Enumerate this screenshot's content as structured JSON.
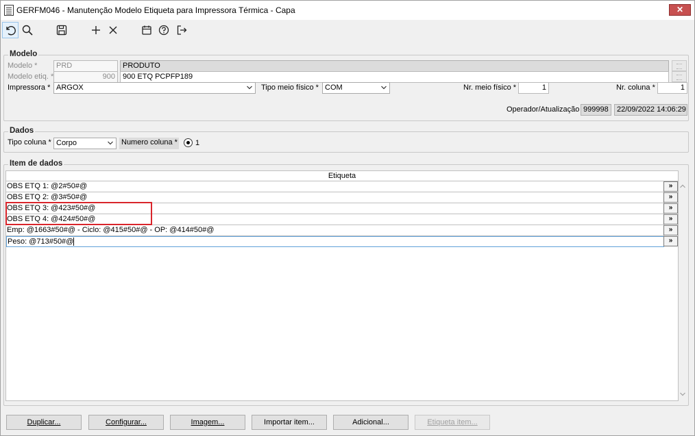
{
  "window": {
    "title": "GERFM046 - Manutenção Modelo Etiqueta para Impressora Térmica - Capa",
    "close_glyph": "✕"
  },
  "toolbar": {
    "icons": [
      "undo-icon",
      "search-icon",
      "save-icon",
      "add-icon",
      "delete-icon",
      "calendar-icon",
      "help-icon",
      "exit-icon"
    ]
  },
  "modelo": {
    "legend": "Modelo",
    "modelo_label": "Modelo *",
    "modelo_code": "PRD",
    "modelo_desc": "PRODUTO",
    "modelo_etiq_label": "Modelo etiq. *",
    "modelo_etiq_code": "900",
    "modelo_etiq_desc": "900 ETQ PCPFP189",
    "impressora_label": "Impressora *",
    "impressora_value": "ARGOX",
    "tipo_meio_label": "Tipo meio físico *",
    "tipo_meio_value": "COM",
    "nr_meio_label": "Nr. meio físico *",
    "nr_meio_value": "1",
    "nr_coluna_label": "Nr. coluna *",
    "nr_coluna_value": "1",
    "operador_label": "Operador/Atualização",
    "operador_value": "999998",
    "atualizacao_value": "22/09/2022 14:06:29"
  },
  "dados": {
    "legend": "Dados",
    "tipo_coluna_label": "Tipo coluna *",
    "tipo_coluna_value": "Corpo",
    "numero_coluna_label": "Numero coluna *",
    "numero_coluna_value": "1"
  },
  "item_dados": {
    "legend": "Item de dados",
    "column_header": "Etiqueta",
    "row_button": "»",
    "rows": [
      "OBS ETQ 1: @2#50#@",
      "OBS ETQ 2: @3#50#@",
      "OBS ETQ 3: @423#50#@",
      "OBS ETQ 4: @424#50#@",
      "Emp: @1663#50#@ - Ciclo: @415#50#@ - OP: @414#50#@",
      "Peso: @713#50#@"
    ]
  },
  "buttons": {
    "duplicar": "Duplicar...",
    "configurar": "Configurar...",
    "imagem": "Imagem...",
    "importar": "Importar item...",
    "adicional": "Adicional...",
    "etiqueta_item": "Etiqueta item..."
  },
  "colors": {
    "highlight": "#d9252b",
    "close": "#c75050"
  }
}
